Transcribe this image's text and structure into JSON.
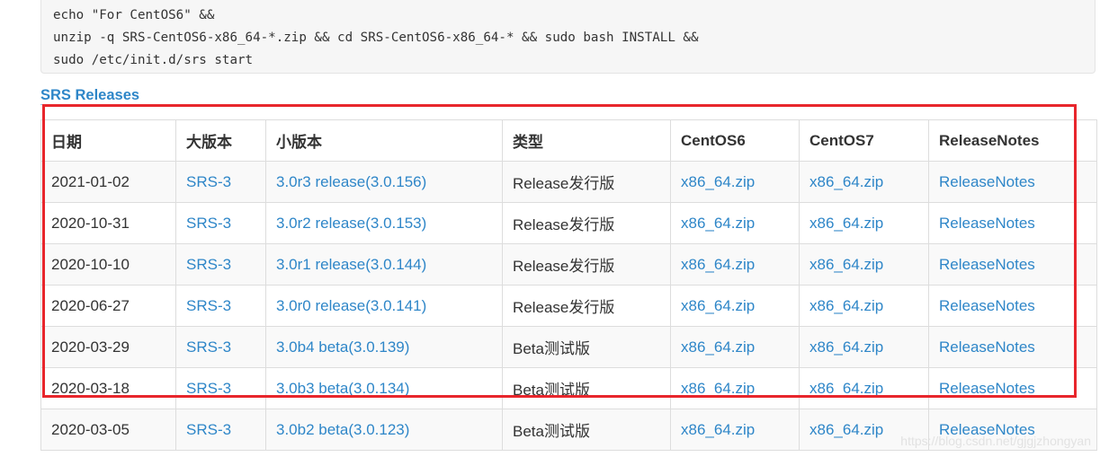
{
  "code": {
    "lines": [
      "echo \"For CentOS6\" &&",
      "unzip -q SRS-CentOS6-x86_64-*.zip && cd SRS-CentOS6-x86_64-* && sudo bash INSTALL &&",
      "sudo /etc/init.d/srs start"
    ]
  },
  "releases_link": "SRS Releases",
  "table": {
    "headers": [
      "日期",
      "大版本",
      "小版本",
      "类型",
      "CentOS6",
      "CentOS7",
      "ReleaseNotes"
    ],
    "rows": [
      {
        "date": "2021-01-02",
        "major": "SRS-3",
        "minor": "3.0r3 release(3.0.156)",
        "type": "Release发行版",
        "centos6": "x86_64.zip",
        "centos7": "x86_64.zip",
        "notes": "ReleaseNotes"
      },
      {
        "date": "2020-10-31",
        "major": "SRS-3",
        "minor": "3.0r2 release(3.0.153)",
        "type": "Release发行版",
        "centos6": "x86_64.zip",
        "centos7": "x86_64.zip",
        "notes": "ReleaseNotes"
      },
      {
        "date": "2020-10-10",
        "major": "SRS-3",
        "minor": "3.0r1 release(3.0.144)",
        "type": "Release发行版",
        "centos6": "x86_64.zip",
        "centos7": "x86_64.zip",
        "notes": "ReleaseNotes"
      },
      {
        "date": "2020-06-27",
        "major": "SRS-3",
        "minor": "3.0r0 release(3.0.141)",
        "type": "Release发行版",
        "centos6": "x86_64.zip",
        "centos7": "x86_64.zip",
        "notes": "ReleaseNotes"
      },
      {
        "date": "2020-03-29",
        "major": "SRS-3",
        "minor": "3.0b4 beta(3.0.139)",
        "type": "Beta测试版",
        "centos6": "x86_64.zip",
        "centos7": "x86_64.zip",
        "notes": "ReleaseNotes"
      },
      {
        "date": "2020-03-18",
        "major": "SRS-3",
        "minor": "3.0b3 beta(3.0.134)",
        "type": "Beta测试版",
        "centos6": "x86_64.zip",
        "centos7": "x86_64.zip",
        "notes": "ReleaseNotes"
      },
      {
        "date": "2020-03-05",
        "major": "SRS-3",
        "minor": "3.0b2 beta(3.0.123)",
        "type": "Beta测试版",
        "centos6": "x86_64.zip",
        "centos7": "x86_64.zip",
        "notes": "ReleaseNotes"
      }
    ]
  },
  "watermark": "https://blog.csdn.net/gjgjzhongyan",
  "colors": {
    "link": "#2e86c8",
    "highlight": "#e8262c",
    "code_bg": "#f6f6f6"
  }
}
